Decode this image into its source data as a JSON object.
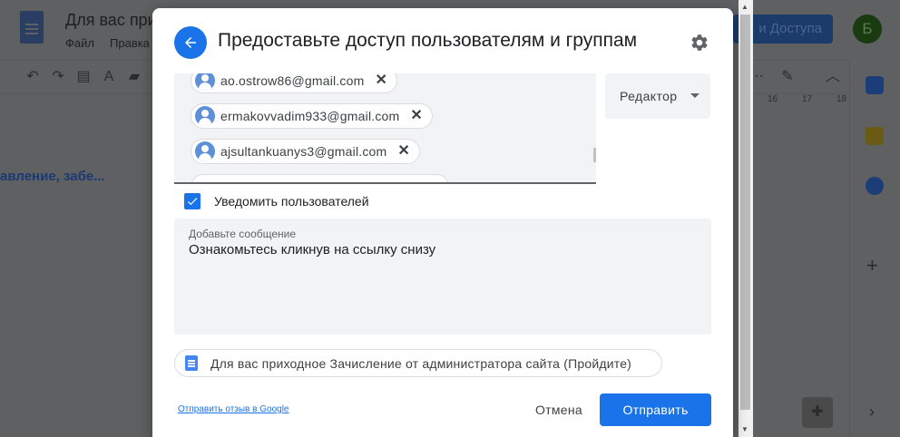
{
  "background": {
    "doc_title": "Для вас при",
    "menu": [
      "Файл",
      "Правка"
    ],
    "share_button": "и Доступа",
    "avatar_letter": "Б",
    "doc_text": "авление, забе...",
    "ruler_numbers": [
      "16",
      "17",
      "18"
    ]
  },
  "dialog": {
    "title": "Предоставьте доступ пользователям и группам",
    "chips": [
      {
        "email": "ao.ostrow86@gmail.com"
      },
      {
        "email": "ermakovvadim933@gmail.com"
      },
      {
        "email": "ajsultankuanys3@gmail.com"
      }
    ],
    "role": "Редактор",
    "notify": {
      "label": "Уведомить пользователей",
      "checked": true
    },
    "message": {
      "label": "Добавьте сообщение",
      "value": "Ознакомьтесь кликнув на ссылку снизу"
    },
    "doc_chip": "Для вас приходное Зачисление от администратора сайта (Пройдите)",
    "feedback_link": "Отправить отзыв в Google",
    "cancel": "Отмена",
    "send": "Отправить"
  },
  "colors": {
    "accent": "#1a73e8",
    "overlay": "#5f6061"
  }
}
